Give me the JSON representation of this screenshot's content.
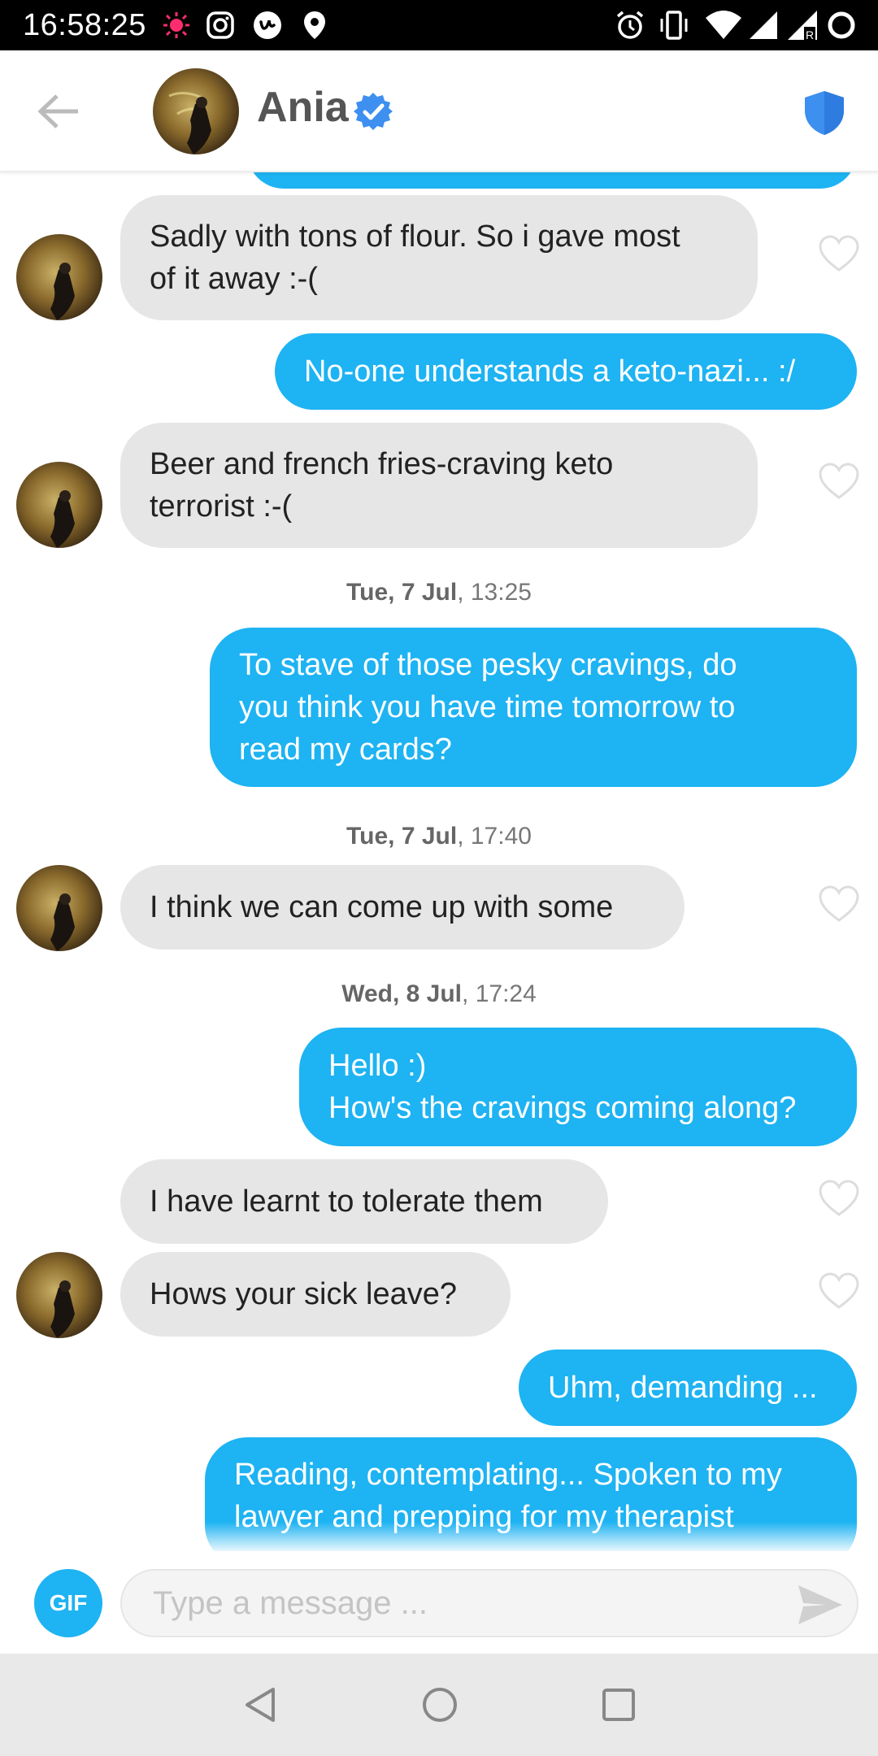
{
  "status_bar": {
    "time": "16:58:25",
    "icons": [
      "sun-notification-icon",
      "instagram-icon",
      "tinder-u-icon",
      "location-icon",
      "alarm-icon",
      "vibrate-icon",
      "wifi-icon",
      "signal-icon",
      "signal-roaming-icon",
      "battery-ring-icon"
    ]
  },
  "header": {
    "name": "Ania",
    "verified": true,
    "accent": "#3d8ff0"
  },
  "conversation": {
    "messages": [
      {
        "from": "them",
        "text": "Sadly with tons of flour. So i gave most\nof it away :-("
      },
      {
        "from": "me",
        "text": "No-one understands a keto-nazi... :/"
      },
      {
        "from": "them",
        "text": "Beer and french fries-craving keto\nterrorist :-("
      },
      {
        "timestamp_day": "Tue, 7 Jul",
        "timestamp_time": ", 13:25"
      },
      {
        "from": "me",
        "text": "To stave of those pesky cravings, do\nyou think you have time tomorrow to\nread my cards?"
      },
      {
        "timestamp_day": "Tue, 7 Jul",
        "timestamp_time": ", 17:40"
      },
      {
        "from": "them",
        "text": "I think we can come up with some"
      },
      {
        "timestamp_day": "Wed, 8 Jul",
        "timestamp_time": ", 17:24"
      },
      {
        "from": "me",
        "text": "Hello :)\nHow's the cravings coming along?"
      },
      {
        "from": "them",
        "text": "I have learnt to tolerate them"
      },
      {
        "from": "them",
        "text": "Hows your sick leave?"
      },
      {
        "from": "me",
        "text": "Uhm, demanding ..."
      },
      {
        "from": "me",
        "text": "Reading, contemplating... Spoken to my\nlawyer and prepping for my therapist"
      }
    ]
  },
  "composer": {
    "gif_label": "GIF",
    "placeholder": "Type a message ..."
  },
  "colors": {
    "outgoing_bubble": "#1eb3f2",
    "incoming_bubble": "#e6e6e6"
  }
}
